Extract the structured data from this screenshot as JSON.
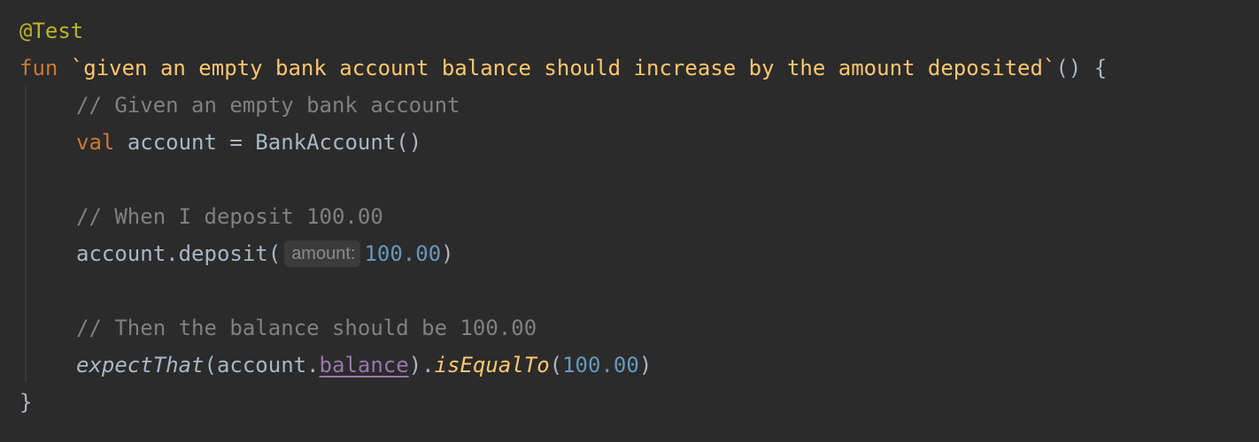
{
  "editor": {
    "lines": {
      "annotation": {
        "text": "@Test"
      },
      "signature": {
        "keyword": "fun",
        "name": "`given an empty bank account balance should increase by the amount deposited`",
        "rest": "() {"
      },
      "comment_given": {
        "text": "// Given an empty bank account"
      },
      "val_decl": {
        "keyword": "val",
        "rest": "account = BankAccount()"
      },
      "comment_when": {
        "text": "// When I deposit 100.00"
      },
      "deposit_call": {
        "prefix": "account.deposit(",
        "hint": "amount:",
        "number": "100.00",
        "suffix": ")"
      },
      "comment_then": {
        "text": "// Then the balance should be 100.00"
      },
      "assert_call": {
        "fn": "expectThat",
        "open": "(account.",
        "property": "balance",
        "mid": ").",
        "matcher": "isEqualTo",
        "open2": "(",
        "number": "100.00",
        "close": ")"
      },
      "closing_brace": {
        "text": "}"
      }
    }
  }
}
